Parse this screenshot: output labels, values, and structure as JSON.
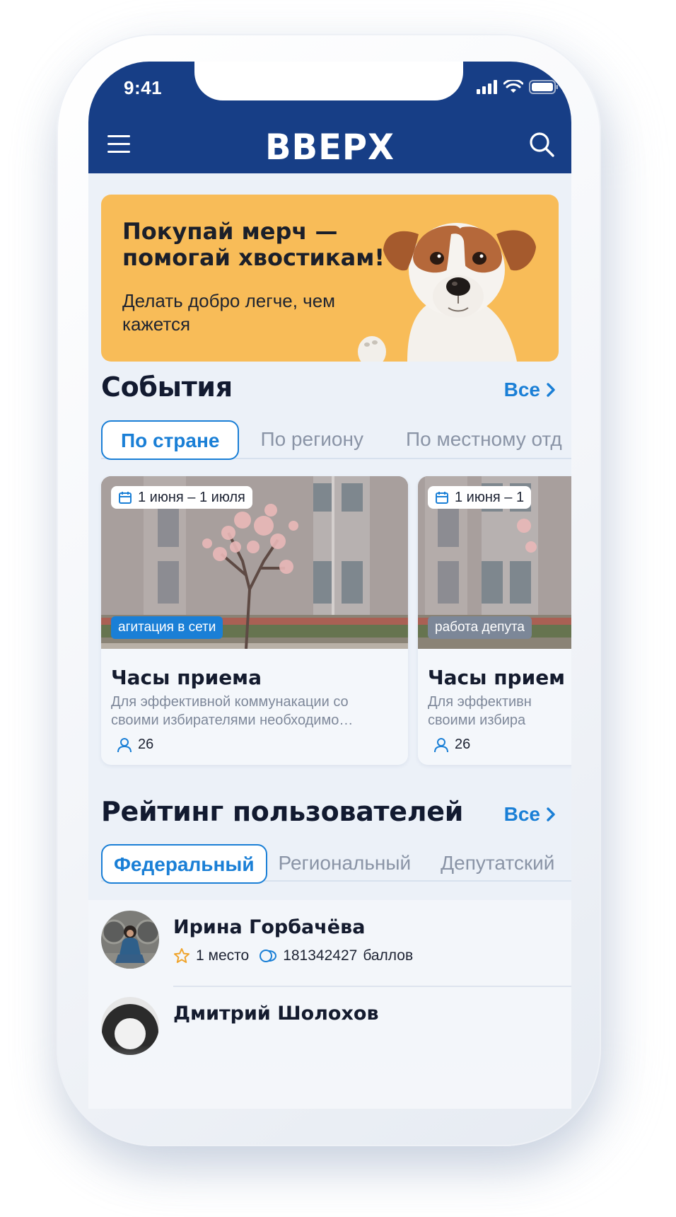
{
  "status_bar": {
    "time": "9:41"
  },
  "header": {
    "logo": "ВВЕРХ",
    "menu_icon": "hamburger-menu-icon",
    "search_icon": "search-icon",
    "background": "#173e86"
  },
  "banner": {
    "title": "Покупай мерч — помогай хвостикам!",
    "subtitle": "Делать добро легче, чем кажется",
    "background": "#f8bc58"
  },
  "events": {
    "title": "События",
    "see_all": "Все",
    "tabs": [
      {
        "label": "По стране",
        "active": true
      },
      {
        "label": "По региону",
        "active": false
      },
      {
        "label": "По местному отд",
        "active": false
      }
    ],
    "cards": [
      {
        "date": "1 июня – 1 июля",
        "tag": "агитация в сети",
        "tag_color": "#1a7fd6",
        "title": "Часы приема",
        "description": "Для эффективной коммунакации со своими избирателями необходимо…",
        "participants": "26"
      },
      {
        "date": "1 июня – 1",
        "tag": "работа депута",
        "tag_color": "#7c8798",
        "title": "Часы прием",
        "description": "Для эффективн своими избира",
        "participants": "26"
      }
    ]
  },
  "rating": {
    "title": "Рейтинг пользователей",
    "see_all": "Все",
    "tabs": [
      {
        "label": "Федеральный",
        "active": true
      },
      {
        "label": "Региональный",
        "active": false
      },
      {
        "label": "Депутатский",
        "active": false
      }
    ],
    "users": [
      {
        "name": "Ирина Горбачёва",
        "place": "1 место",
        "points": "181342427",
        "points_label": "баллов"
      },
      {
        "name": "Дмитрий Шолохов"
      }
    ]
  },
  "colors": {
    "accent": "#1a7fd6",
    "brand": "#173e86",
    "banner": "#f8bc58"
  }
}
